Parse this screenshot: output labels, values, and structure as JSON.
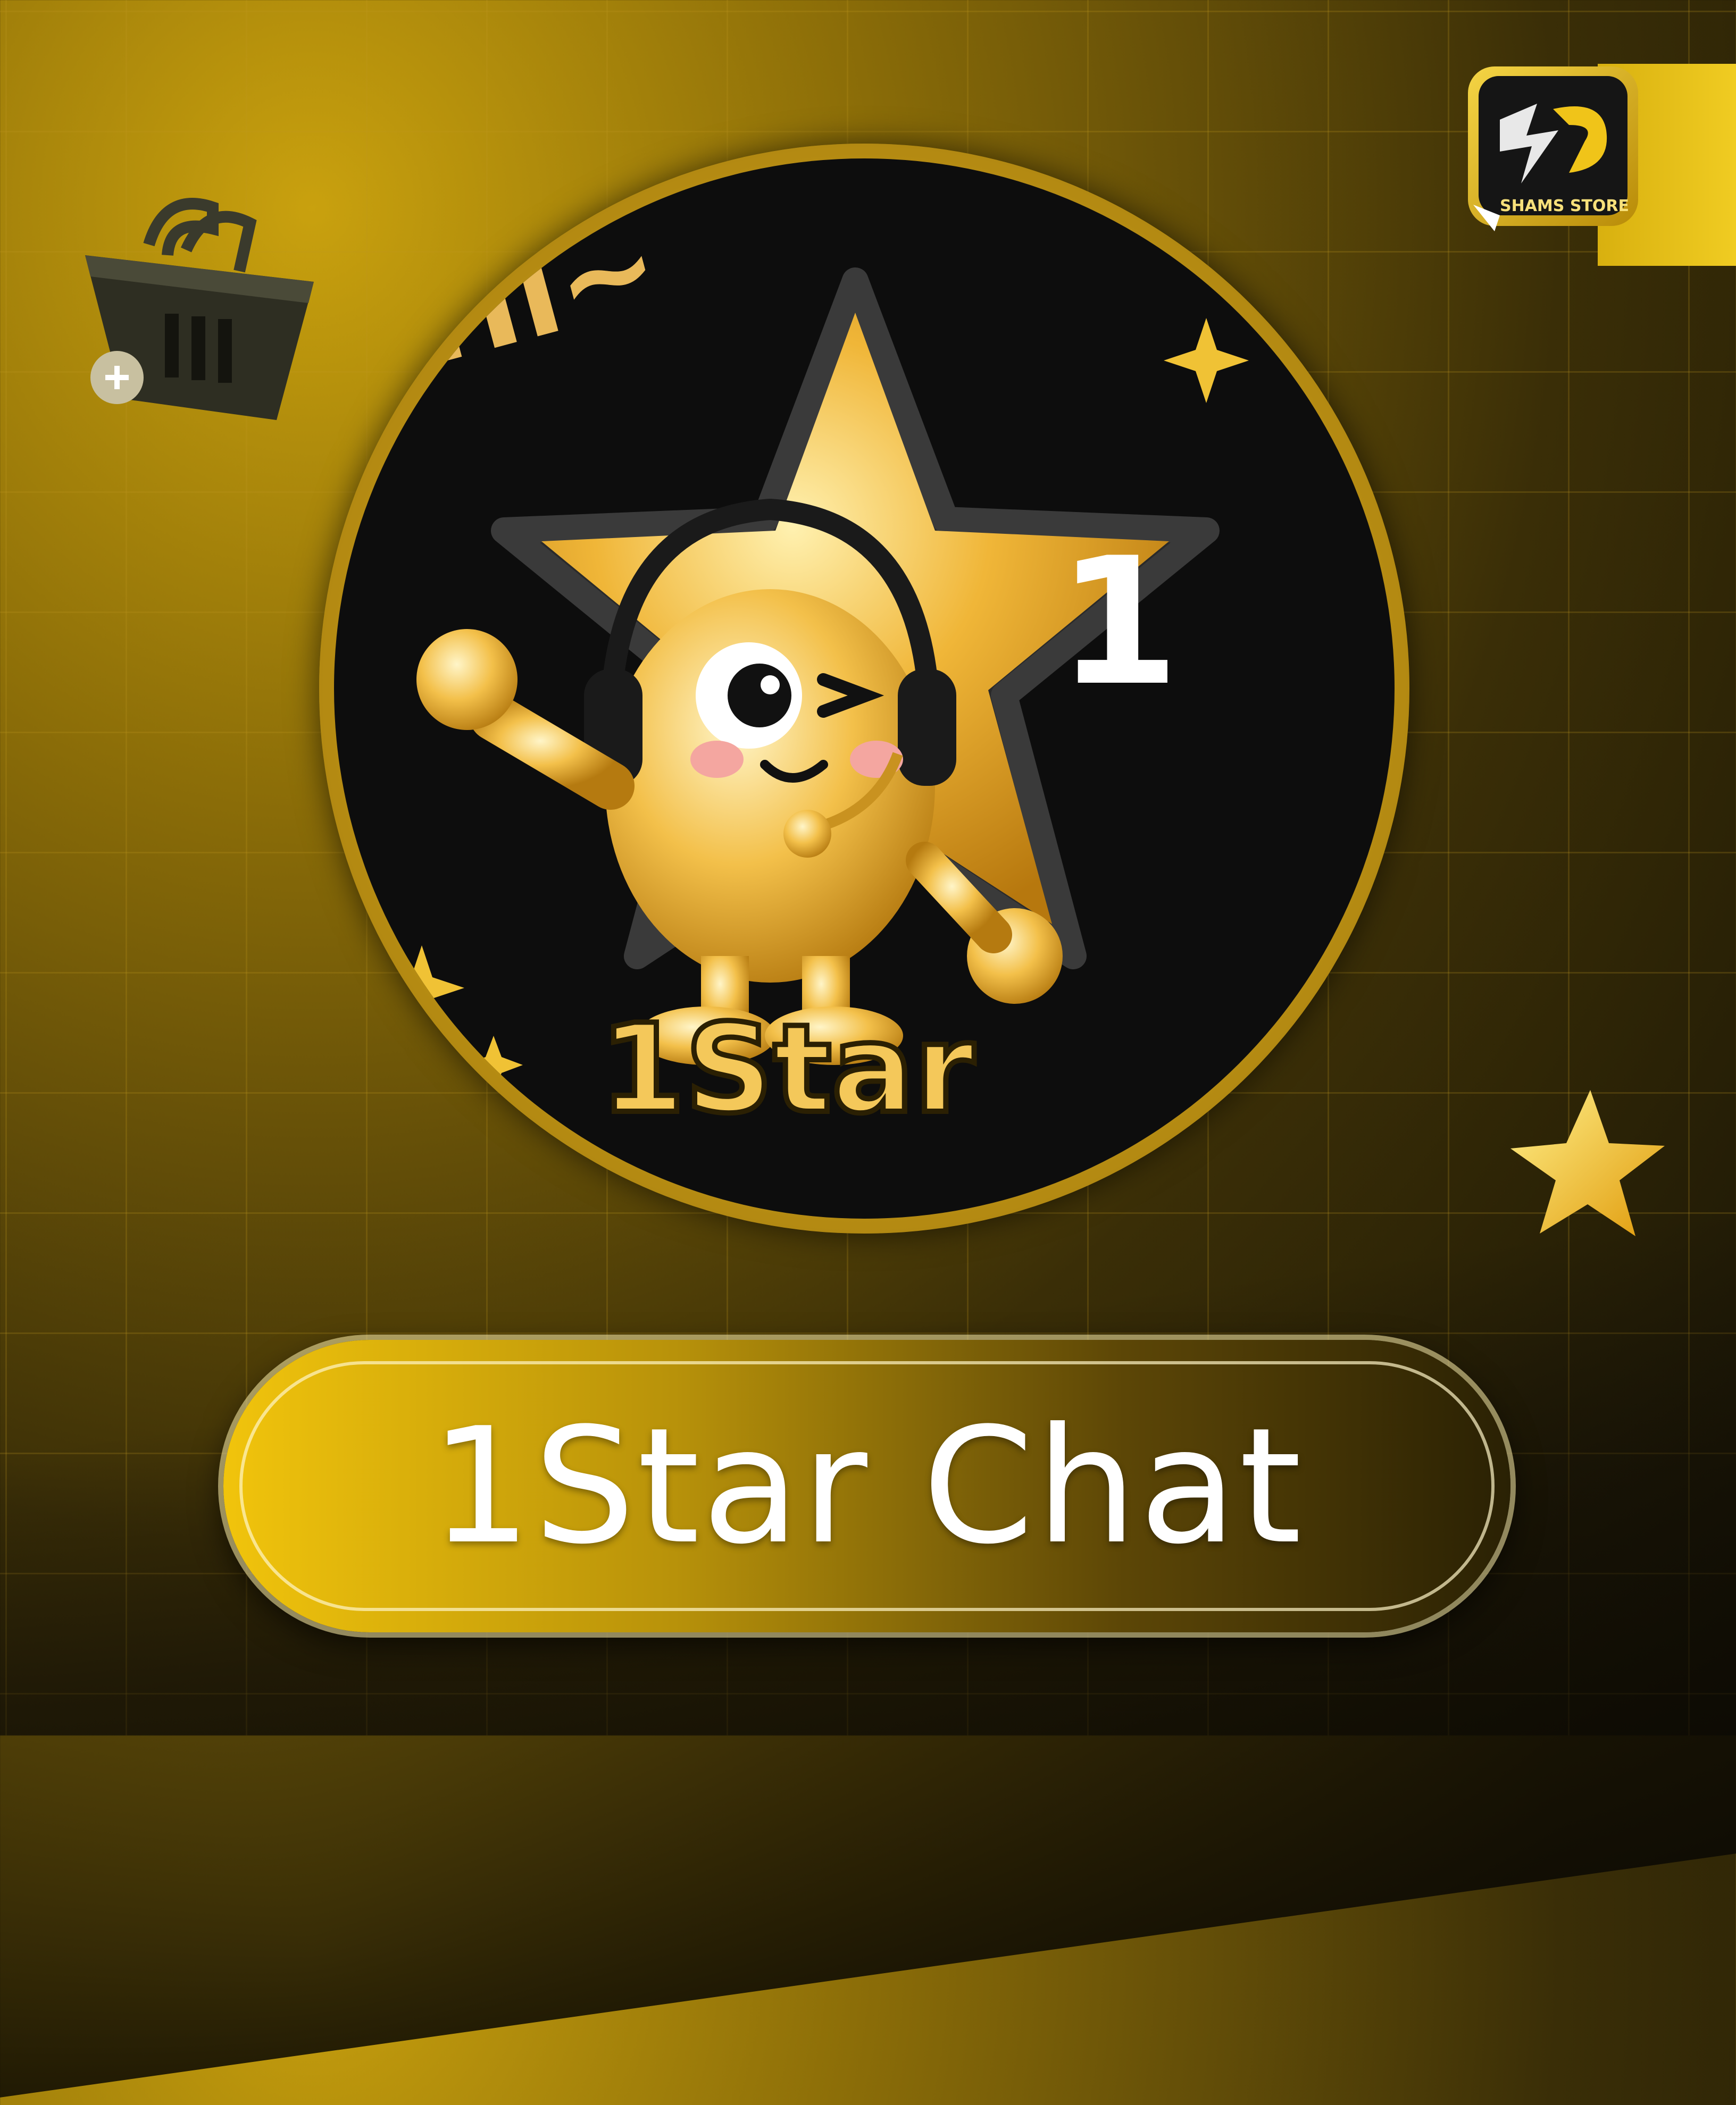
{
  "brand": {
    "logo_text": "SHAMS STORE",
    "accent_gold": "#f1c40c",
    "dark": "#0d0d0d"
  },
  "badge": {
    "greeting": "Hi~",
    "star_number": "1",
    "badge_label": "1Star"
  },
  "title": {
    "text": "1Star Chat"
  },
  "icons": [
    "shopping-basket-icon",
    "shams-store-logo",
    "mascot-star-icon",
    "sparkle-icon",
    "gold-star-icon"
  ]
}
